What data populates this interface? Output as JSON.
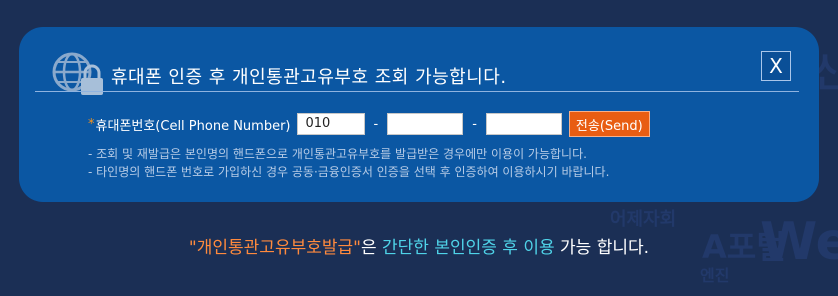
{
  "background": {
    "words": [
      "신",
      "어제자회",
      "A포털",
      "We",
      "엔진"
    ]
  },
  "modal": {
    "title": "휴대폰 인증 후 개인통관고유부호 조회 가능합니다.",
    "close_label": "X",
    "form": {
      "required_mark": "*",
      "label": "휴대폰번호(Cell Phone Number)",
      "prefix_value": "010",
      "separator": "-",
      "middle_value": "",
      "last_value": "",
      "send_label": "전송(Send)"
    },
    "notes": [
      "- 조회 및 재발급은 본인명의 핸드폰으로 개인통관고유부호를 발급받은 경우에만 이용이 가능합니다.",
      "- 타인명의 핸드폰 번호로 가입하신 경우 공동·금융인증서 인증을 선택 후 인증하여 이용하시기 바랍니다."
    ]
  },
  "footer": {
    "quote": "\"개인통관고유부호발급\"",
    "part2": "은 ",
    "highlight": "간단한 본인인증 후 이용",
    "part3": " 가능 합니다."
  },
  "colors": {
    "page_bg": "#1b2f55",
    "modal_bg": "#0b57a3",
    "send_button": "#e85d12",
    "accent_orange": "#ff8a3d",
    "accent_cyan": "#4fd3e8"
  }
}
